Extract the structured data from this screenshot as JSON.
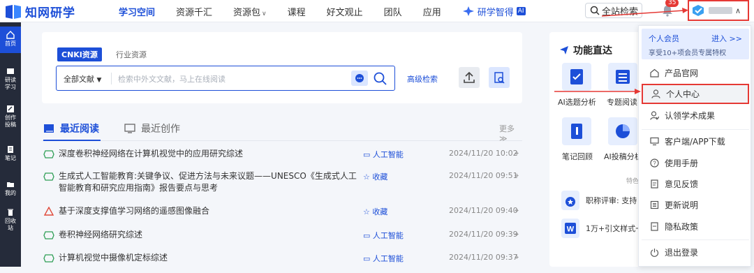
{
  "header": {
    "logo": "知网研学",
    "nav": [
      {
        "label": "学习空间",
        "active": true
      },
      {
        "label": "资源千汇"
      },
      {
        "label": "资源包",
        "dropdown": true
      },
      {
        "label": "课程"
      },
      {
        "label": "好文观止"
      },
      {
        "label": "团队"
      },
      {
        "label": "应用"
      }
    ],
    "ai_nav": {
      "label": "研学智得",
      "badge": "AI"
    },
    "site_search": "全站检索",
    "notification_count": "35"
  },
  "sidebar": [
    {
      "label": "首页",
      "active": true
    },
    {
      "label": "研读\n学习"
    },
    {
      "label": "创作\n投稿"
    },
    {
      "label": "笔记"
    },
    {
      "label": "我的"
    },
    {
      "label": "回收\n站"
    }
  ],
  "search": {
    "tabs": [
      "CNKI资源",
      "行业资源"
    ],
    "scope": "全部文献",
    "placeholder": "检索中外文文献，马上在线阅读",
    "advanced": "高级检索"
  },
  "recent": {
    "tabs": [
      "最近阅读",
      "最近创作"
    ],
    "more": "更多≫",
    "rows": [
      {
        "title": "深度卷积神经网络在计算机视觉中的应用研究综述",
        "tag": "人工智能",
        "tag_icon": "folder",
        "time": "2024/11/20 10:02",
        "doc": "kms"
      },
      {
        "title": "生成式人工智能教育:关键争议、促进方法与未来议题——UNESCO《生成式人工智能教育和研究应用指南》报告要点与思考",
        "tag": "收藏",
        "tag_icon": "star",
        "time": "2024/11/20 09:51",
        "doc": "kms"
      },
      {
        "title": "基于深度支撑值学习网络的遥感图像融合",
        "tag": "收藏",
        "tag_icon": "star",
        "time": "2024/11/20 09:40",
        "doc": "pdf"
      },
      {
        "title": "卷积神经网络研究综述",
        "tag": "人工智能",
        "tag_icon": "folder",
        "time": "2024/11/20 09:39",
        "doc": "kms"
      },
      {
        "title": "计算机视觉中摄像机定标综述",
        "tag": "人工智能",
        "tag_icon": "folder",
        "time": "2024/11/20 09:37",
        "doc": "kms"
      }
    ]
  },
  "functions": {
    "title": "功能直达",
    "items": [
      {
        "label": "AI选题分析"
      },
      {
        "label": "专题阅读"
      },
      {
        "label": "笔记回顾"
      },
      {
        "label": "AI投稿分析"
      }
    ],
    "section_label": "特色",
    "features": [
      {
        "label": "职称评审: 支持"
      },
      {
        "label": "1万+引文样式一"
      }
    ]
  },
  "dropdown": {
    "member_title": "个人会员",
    "member_enter": "进入 >>",
    "member_sub": "享受10+项会员专属特权",
    "items": [
      {
        "label": "产品官网",
        "icon": "home-icon"
      },
      {
        "label": "个人中心",
        "icon": "user-icon",
        "highlight": true
      },
      {
        "label": "认领学术成果",
        "icon": "claim-icon"
      },
      {
        "label": "客户端/APP下载",
        "icon": "download-icon"
      },
      {
        "label": "使用手册",
        "icon": "help-icon"
      },
      {
        "label": "意见反馈",
        "icon": "feedback-icon"
      },
      {
        "label": "更新说明",
        "icon": "update-icon"
      },
      {
        "label": "隐私政策",
        "icon": "privacy-icon"
      },
      {
        "label": "退出登录",
        "icon": "logout-icon"
      }
    ]
  },
  "colors": {
    "accent": "#1d4fd8",
    "highlight": "#e53935",
    "sidebar": "#252b3a"
  }
}
